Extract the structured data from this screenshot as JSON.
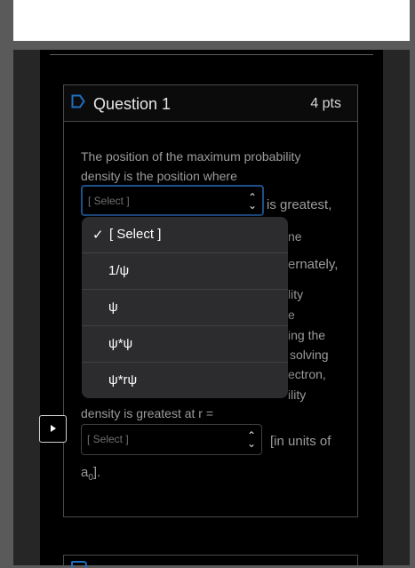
{
  "question": {
    "title": "Question 1",
    "points": "4 pts"
  },
  "text": {
    "line1": "The position of the maximum probability",
    "line2": "density is the position where",
    "after_select1": "is greatest,",
    "frag_ne": "ne",
    "frag_ernately": "ernately,",
    "frag_lity": "lity",
    "frag_e": "e",
    "frag_ing_the": "ing the",
    "frag_solving": "solving",
    "frag_ectron": "ectron,",
    "frag_lity2": "ility",
    "line_r": "density is greatest at r =",
    "after_select2": "[in units of",
    "units": "a",
    "units_sub": "0",
    "units_end": "]."
  },
  "select1": {
    "value": "[ Select ]"
  },
  "select2": {
    "value": "[ Select ]"
  },
  "dropdown": {
    "options": [
      {
        "label": "[ Select ]",
        "checked": true
      },
      {
        "label": "1/ψ",
        "checked": false
      },
      {
        "label": "ψ",
        "checked": false
      },
      {
        "label": "ψ*ψ",
        "checked": false
      },
      {
        "label": "ψ*rψ",
        "checked": false
      }
    ],
    "check_mark": "✓"
  },
  "colors": {
    "focus_border": "#1f4f8a",
    "flag_accent": "#1f6ec0",
    "menu_bg": "#2c2c2e"
  }
}
